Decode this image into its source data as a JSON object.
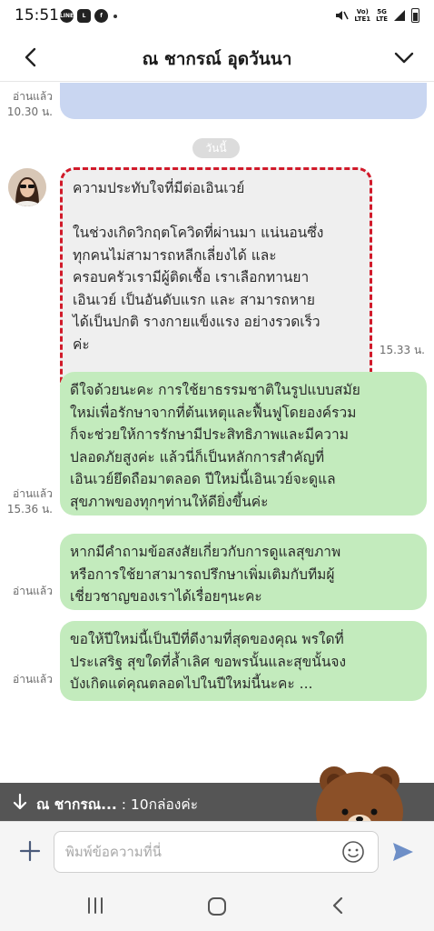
{
  "status_bar": {
    "time": "15:51",
    "network_top": "Vo)",
    "network_bottom": "LTE1",
    "gen_top": "5G",
    "gen_bottom": "LTE",
    "apps": [
      "line-icon",
      "line-icon",
      "facebook-icon"
    ]
  },
  "header": {
    "title": "ณ ชากรณ์ อุดวันนา"
  },
  "previous": {
    "read": "อ่านแล้ว",
    "time": "10.30 น."
  },
  "date_chip": "วันนี้",
  "messages": {
    "incoming": {
      "line1": "ความประทับใจที่มีต่อเอินเวย์",
      "line2": "ในช่วงเกิดวิกฤตโควิดที่ผ่านมา แน่นอนซึ่ง",
      "line3": "ทุกคนไม่สามารถหลีกเลี่ยงได้  และ",
      "line4": "ครอบครัวเรามีผู้ติดเชื้อ   เราเลือกทานยา",
      "line5": "เอินเวย์ เป็นอันดับแรก  และ สามารถหาย",
      "line6": "ได้เป็นปกติ รางกายแข็งแรง อย่างรวดเร็ว",
      "line7": "ค่ะ",
      "time": "15.33 น."
    },
    "out1": {
      "line1": "ดีใจด้วยนะคะ การใช้ยาธรรมชาติในรูปแบบสมัย",
      "line2": "ใหม่เพื่อรักษาจากที่ต้นเหตุและฟื้นฟูโดยองค์รวม",
      "line3": "ก็จะช่วยให้การรักษามีประสิทธิภาพและมีความ",
      "line4": "ปลอดภัยสูงค่ะ แล้วนี่ก็เป็นหลักการสำคัญที่",
      "line5": "เอินเวย์ยึดถือมาตลอด ปีใหม่นี้เอินเวย์จะดูแล",
      "line6": "สุขภาพของทุกๆท่านให้ดียิ่งขึ้นค่ะ",
      "read": "อ่านแล้ว",
      "time": "15.36 น."
    },
    "out2": {
      "line1": "หากมีคำถามข้อสงสัยเกี่ยวกับการดูแลสุขภาพ",
      "line2": "หรือการใช้ยาสามารถปรึกษาเพิ่มเติมกับทีมผู้",
      "line3": "เชี่ยวชาญของเราได้เรื่อยๆนะคะ",
      "read": "อ่านแล้ว"
    },
    "out3": {
      "line1": "ขอให้ปีใหม่นี้เป็นปีที่ดีงามที่สุดของคุณ พรใดที่",
      "line2": "ประเสริฐ สุขใดที่ล้ำเลิศ ขอพรนั้นและสุขนั้นจง",
      "line3": "บังเกิดแด่คุณตลอดไปในปีใหม่นี้นะคะ ...",
      "read": "อ่านแล้ว"
    }
  },
  "notice": {
    "sender": "ณ ชากรณ...",
    "text": " : 10กล่องค่ะ"
  },
  "input": {
    "placeholder": "พิมพ์ข้อความที่นี่"
  },
  "colors": {
    "incoming_bubble": "#efefef",
    "outgoing_bubble": "#c3ebbd",
    "previous_bubble": "#c9d6f1",
    "highlight_border": "#d11a2a",
    "send_accent": "#6e8fc7"
  }
}
